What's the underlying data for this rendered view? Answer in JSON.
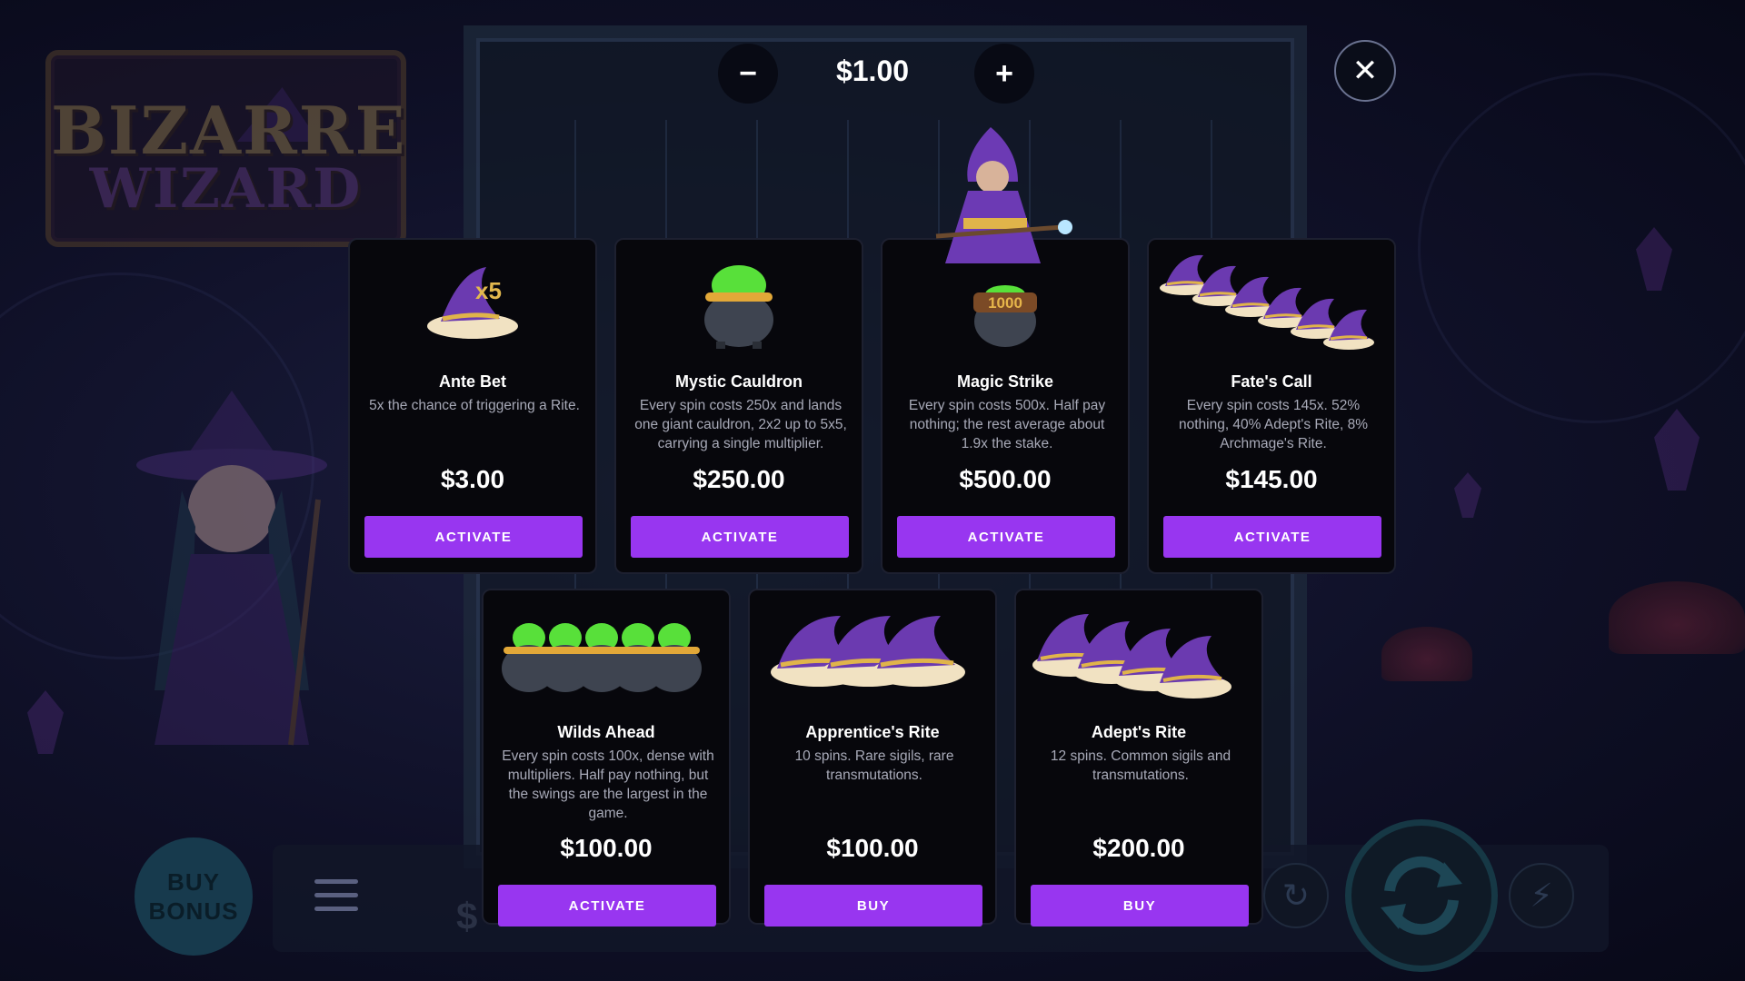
{
  "bet": {
    "value": "$1.00",
    "decrease_label": "−",
    "increase_label": "+"
  },
  "close_label": "✕",
  "logo": {
    "line1": "BIZARRE",
    "line2": "WIZARD"
  },
  "hud": {
    "buy_bonus_label": "BUY BONUS",
    "currency_fragment": "$"
  },
  "cards": [
    {
      "title": "Ante Bet",
      "description": "5x the chance of triggering a Rite.",
      "price": "$3.00",
      "button": "ACTIVATE",
      "icon": "witch-hat-x5-icon"
    },
    {
      "title": "Mystic Cauldron",
      "description": "Every spin costs 250x and lands one giant cauldron, 2x2 up to 5x5, carrying a single multiplier.",
      "price": "$250.00",
      "button": "ACTIVATE",
      "icon": "cauldron-icon"
    },
    {
      "title": "Magic Strike",
      "description": "Every spin costs 500x. Half pay nothing; the rest average about 1.9x the stake.",
      "price": "$500.00",
      "button": "ACTIVATE",
      "icon": "wizard-cauldron-1000-icon",
      "icon_text": "1000"
    },
    {
      "title": "Fate's Call",
      "description": "Every spin costs 145x. 52% nothing, 40% Adept's Rite, 8% Archmage's Rite.",
      "price": "$145.00",
      "button": "ACTIVATE",
      "icon": "six-hats-icon"
    },
    {
      "title": "Wilds Ahead",
      "description": "Every spin costs 100x, dense with multipliers. Half pay nothing, but the swings are the largest in the game.",
      "price": "$100.00",
      "button": "ACTIVATE",
      "icon": "five-cauldrons-icon"
    },
    {
      "title": "Apprentice's Rite",
      "description": "10 spins. Rare sigils, rare transmutations.",
      "price": "$100.00",
      "button": "BUY",
      "icon": "three-hats-icon"
    },
    {
      "title": "Adept's Rite",
      "description": "12 spins. Common sigils and transmutations.",
      "price": "$200.00",
      "button": "BUY",
      "icon": "four-hats-icon"
    }
  ],
  "colors": {
    "button": "#9836f0",
    "card_bg": "#07070c",
    "background": "#0f1027"
  }
}
